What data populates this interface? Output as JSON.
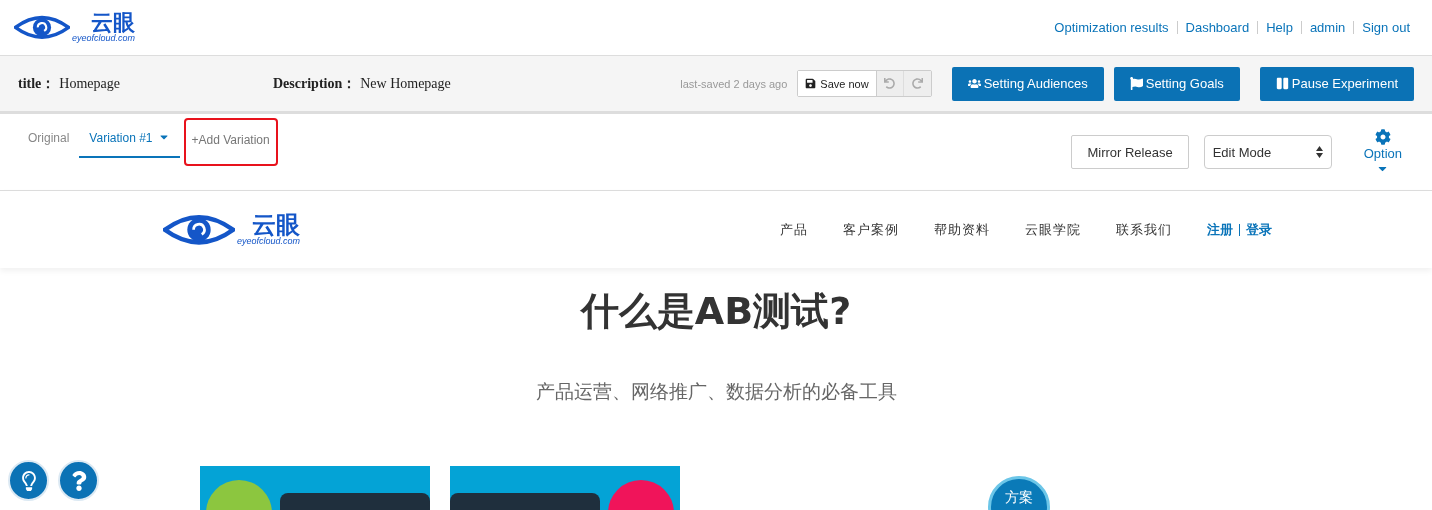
{
  "header": {
    "logo": {
      "name": "云眼",
      "domain": "eyeofcloud.com"
    },
    "links": [
      "Optimization results",
      "Dashboard",
      "Help",
      "admin",
      "Sign out"
    ]
  },
  "toolbar": {
    "fields": [
      {
        "label": "title：",
        "value": "Homepage"
      },
      {
        "label": "Description：",
        "value": "New Homepage"
      }
    ],
    "saved_note": "last-saved 2 days ago",
    "save_button": "Save now",
    "buttons": [
      {
        "kind": "users",
        "label": "Setting Audiences"
      },
      {
        "kind": "flag",
        "label": "Setting Goals"
      },
      {
        "kind": "pause",
        "label": "Pause Experiment"
      }
    ]
  },
  "variations": {
    "tabs": [
      {
        "label": "Original",
        "selected": false,
        "dropdown": false
      },
      {
        "label": "Variation #1",
        "selected": true,
        "dropdown": true
      }
    ],
    "add_link": {
      "label": "+Add Variation",
      "highlighted": true
    },
    "mirror_button": "Mirror Release",
    "mode_select": {
      "value": "Edit Mode"
    },
    "option": "Option"
  },
  "preview": {
    "logo": {
      "name": "云眼",
      "domain": "eyeofcloud.com"
    },
    "nav": [
      "产品",
      "客户案例",
      "帮助资料",
      "云眼学院",
      "联系我们"
    ],
    "auth": [
      "注册",
      "登录"
    ],
    "headline": "什么是AB测试?",
    "subtitle": "产品运营、网络推广、数据分析的必备工具",
    "cards": [
      {
        "color": "#8cc63f"
      },
      {
        "color": "#f0145a"
      }
    ],
    "bubble": "方案"
  }
}
